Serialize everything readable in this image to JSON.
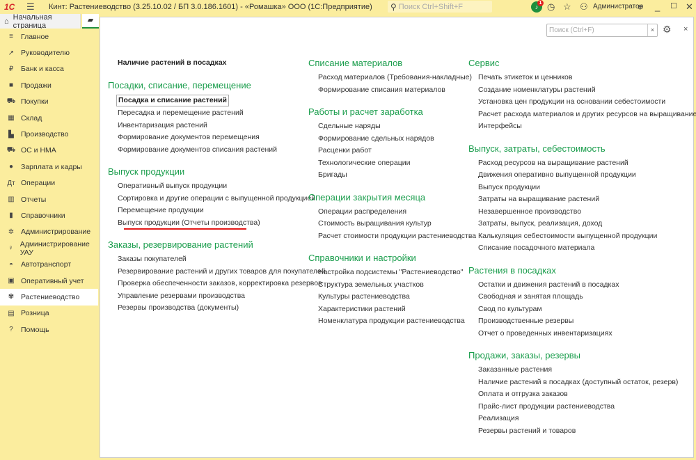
{
  "titlebar": {
    "logo": "1С",
    "title": "Кинт: Растениеводство (3.25.10.02 / БП 3.0.186.1601) - «Ромашка» ООО  (1С:Предприятие)",
    "search_placeholder": "Поиск Ctrl+Shift+F",
    "notifications_count": "1",
    "user": "Администратор"
  },
  "tabs": {
    "home": "Начальная страница"
  },
  "sidebar": {
    "items": [
      {
        "label": "Главное",
        "icon": "≡"
      },
      {
        "label": "Руководителю",
        "icon": "↗"
      },
      {
        "label": "Банк и касса",
        "icon": "₽"
      },
      {
        "label": "Продажи",
        "icon": "■"
      },
      {
        "label": "Покупки",
        "icon": "⛟"
      },
      {
        "label": "Склад",
        "icon": "▦"
      },
      {
        "label": "Производство",
        "icon": "▙"
      },
      {
        "label": "ОС и НМА",
        "icon": "⛟"
      },
      {
        "label": "Зарплата и кадры",
        "icon": "●"
      },
      {
        "label": "Операции",
        "icon": "Дт"
      },
      {
        "label": "Отчеты",
        "icon": "▥"
      },
      {
        "label": "Справочники",
        "icon": "▮"
      },
      {
        "label": "Администрирование",
        "icon": "✲"
      },
      {
        "label": "Администрирование УАУ",
        "icon": "♀"
      },
      {
        "label": "Автотранспорт",
        "icon": "◓"
      },
      {
        "label": "Оперативный учет",
        "icon": "▣"
      },
      {
        "label": "Растениеводство",
        "icon": "✾",
        "active": true
      },
      {
        "label": "Розница",
        "icon": "▤"
      },
      {
        "label": "Помощь",
        "icon": "?"
      }
    ]
  },
  "panel": {
    "search_placeholder": "Поиск (Ctrl+F)",
    "clear": "×",
    "close": "×"
  },
  "columns": [
    {
      "top_item": "Наличие растений в посадках",
      "sections": [
        {
          "title": "Посадки, списание, перемещение",
          "items": [
            "Посадка и списание растений",
            "Пересадка и перемещение растений",
            "Инвентаризация растений",
            "Формирование документов перемещения",
            "Формирование документов списания растений"
          ]
        },
        {
          "title": "Выпуск продукции",
          "items": [
            "Оперативный выпуск продукции",
            "Сортировка и другие операции с выпущенной продукцией",
            "Перемещение продукции",
            "Выпуск продукции (Отчеты производства)"
          ]
        },
        {
          "title": "Заказы, резервирование растений",
          "items": [
            "Заказы покупателей",
            "Резервирование растений и других товаров для покупателей",
            "Проверка обеспеченности заказов, корректировка резервов",
            "Управление резервами производства",
            "Резервы производства (документы)"
          ]
        }
      ]
    },
    {
      "sections": [
        {
          "title": "Списание материалов",
          "items": [
            "Расход материалов (Требования-накладные)",
            "Формирование списания материалов"
          ]
        },
        {
          "title": "Работы и расчет заработка",
          "items": [
            "Сдельные наряды",
            "Формирование сдельных нарядов",
            "Расценки работ",
            "Технологические операции",
            "Бригады"
          ]
        },
        {
          "title": "Операции закрытия месяца",
          "items": [
            "Операции распределения",
            "Стоимость выращивания культур",
            "Расчет стоимости продукции растениеводства"
          ]
        },
        {
          "title": "Справочники и настройки",
          "items": [
            "Настройка подсистемы \"Растениеводство\"",
            "Структура земельных участков",
            "Культуры растениеводства",
            "Характеристики растений",
            "Номенклатура продукции растениеводства"
          ]
        }
      ]
    },
    {
      "sections": [
        {
          "title": "Сервис",
          "items": [
            "Печать этикеток и ценников",
            "Создание номенклатуры растений",
            "Установка цен продукции на основании себестоимости",
            "Расчет расхода материалов и других ресурсов на выращивание растений",
            "Интерфейсы"
          ]
        },
        {
          "title": "Выпуск, затраты, себестоимость",
          "items": [
            "Расход ресурсов на выращивание растений",
            "Движения оперативно выпущенной продукции",
            "Выпуск продукции",
            "Затраты на выращивание растений",
            "Незавершенное производство",
            "Затраты, выпуск, реализация, доход",
            "Калькуляция себестоимости выпущенной продукции",
            "Списание посадочного материала"
          ]
        },
        {
          "title": "Растения в посадках",
          "items": [
            "Остатки и движения растений в посадках",
            "Свободная и занятая площадь",
            "Свод по культурам",
            "Производственные резервы",
            "Отчет о проведенных инвентаризациях"
          ]
        },
        {
          "title": "Продажи, заказы, резервы",
          "items": [
            "Заказанные растения",
            "Наличие растений в посадках (доступный остаток, резерв)",
            "Оплата и отгрузка заказов",
            "Прайс-лист продукции растениеводства",
            "Реализация",
            "Резервы растений и товаров"
          ]
        }
      ]
    }
  ],
  "colors": {
    "accent": "#1a9d4c",
    "sidebar_bg": "#fbed9e",
    "highlight_underline": "#e41b1b"
  }
}
